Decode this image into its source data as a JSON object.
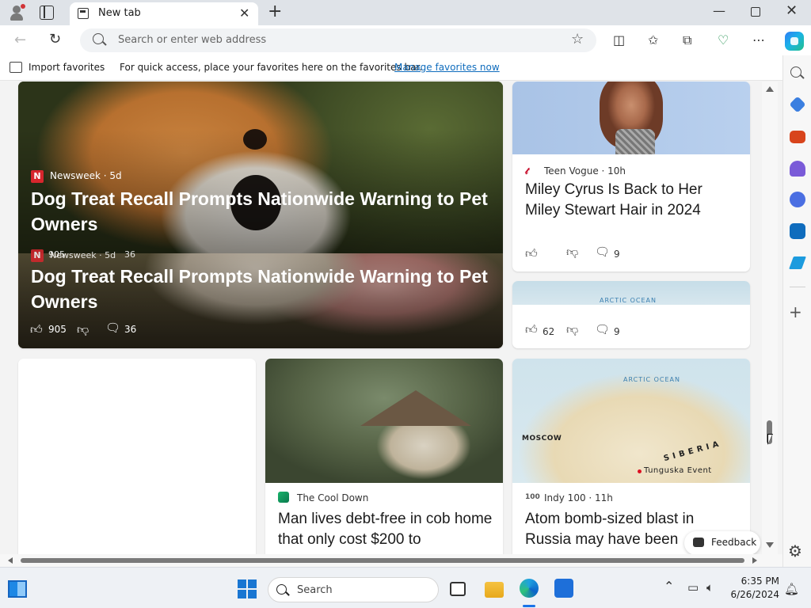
{
  "browser": {
    "tab": {
      "title": "New tab",
      "close": "✕"
    },
    "new_tab": "+",
    "window": {
      "minimize": "—",
      "close": "✕"
    },
    "nav": {
      "back": "←",
      "reload": "↻"
    },
    "address": {
      "placeholder": "Search or enter web address",
      "star": "☆"
    },
    "toolbar_icons": {
      "split": "◫",
      "favorites": "✩",
      "collections": "⧉",
      "browser_essentials": "♡",
      "more": "⋯"
    }
  },
  "favorites_bar": {
    "import_label": "Import favorites",
    "message": "For quick access, place your favorites here on the favorites bar.",
    "manage_link": "Manage favorites now"
  },
  "sidebar": {
    "add": "+",
    "settings": "⚙"
  },
  "colors": {
    "accent": "#0f6cbd",
    "newsweek_red": "#d7262d",
    "tab_strip": "#dfe3e8"
  },
  "feed": {
    "hero": {
      "source": "Newsweek · 5d",
      "logo": "N",
      "title": "Dog Treat Recall Prompts Nationwide Warning to Pet Owners",
      "ghost_source": "Newsweek · 5d",
      "ghost_likes": "905",
      "ghost_comments": "36",
      "likes": "905",
      "comments": "36"
    },
    "teen_vogue": {
      "logo": "𝓉",
      "source": "Teen Vogue · 10h",
      "title": "Miley Cyrus Is Back to Her Miley Stewart Hair in 2024",
      "comments": "9"
    },
    "map_small": {
      "likes": "62",
      "comments": "9",
      "ocean_label": "ARCTIC OCEAN"
    },
    "cob": {
      "source": "The Cool Down",
      "title": "Man lives debt-free in cob home that only cost $200 to"
    },
    "atom": {
      "logo": "100",
      "source": "Indy 100 · 11h",
      "title": "Atom bomb-sized blast in Russia may have been",
      "map_labels": {
        "ocean": "ARCTIC OCEAN",
        "moscow": "MOSCOW",
        "siberia": "S I B E R I A",
        "tunguska": "Tunguska Event"
      }
    }
  },
  "feedback": {
    "label": "Feedback"
  },
  "taskbar": {
    "search_label": "Search",
    "tray_up": "⌃",
    "time": "6:35 PM",
    "date": "6/26/2024"
  }
}
